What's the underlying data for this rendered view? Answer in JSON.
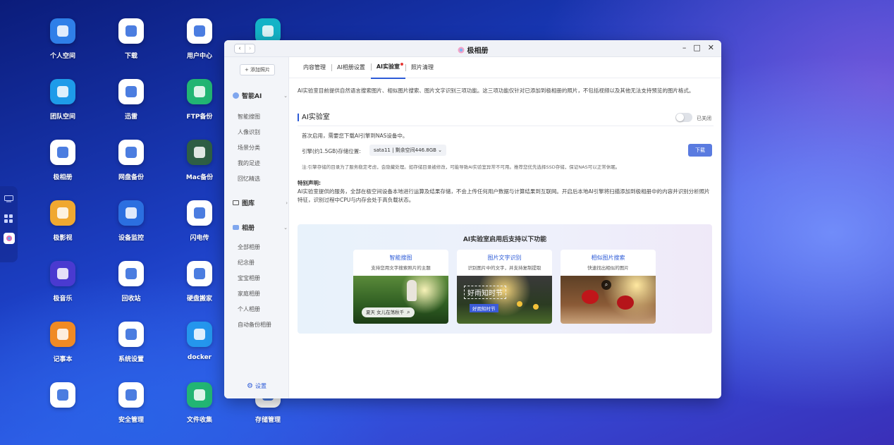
{
  "desktop": {
    "icons": [
      {
        "label": "个人空间",
        "icon": "folder-icon",
        "color": "#2f7fe8"
      },
      {
        "label": "下载",
        "icon": "download-globe-icon",
        "color": "#ffffff"
      },
      {
        "label": "用户中心",
        "icon": "user-avatar-icon",
        "color": "#ffffff"
      },
      {
        "label": "",
        "icon": "audio-wave-icon",
        "color": "#14b3c7"
      },
      {
        "label": "团队空间",
        "icon": "team-folder-icon",
        "color": "#1e9be9"
      },
      {
        "label": "迅雷",
        "icon": "thunder-bird-icon",
        "color": "#ffffff"
      },
      {
        "label": "FTP备份",
        "icon": "ftp-icon",
        "color": "#22b573"
      },
      {
        "label": "极相册",
        "icon": "photo-flower-icon",
        "color": "#ffffff"
      },
      {
        "label": "网盘备份",
        "icon": "cloud-upload-icon",
        "color": "#ffffff"
      },
      {
        "label": "Mac备份",
        "icon": "time-machine-icon",
        "color": "#2e5e44"
      },
      {
        "label": "极影视",
        "icon": "video-icon",
        "color": "#f0a830"
      },
      {
        "label": "设备监控",
        "icon": "chart-monitor-icon",
        "color": "#2b6fe0"
      },
      {
        "label": "闪电传",
        "icon": "lightning-transfer-icon",
        "color": "#ffffff"
      },
      {
        "label": "极音乐",
        "icon": "music-note-icon",
        "color": "#4a3ad0"
      },
      {
        "label": "回收站",
        "icon": "trash-icon",
        "color": "#ffffff"
      },
      {
        "label": "硬盘搬家",
        "icon": "disk-move-icon",
        "color": "#ffffff"
      },
      {
        "label": "记事本",
        "icon": "notepad-icon",
        "color": "#f08a24"
      },
      {
        "label": "系统设置",
        "icon": "settings-dial-icon",
        "color": "#ffffff"
      },
      {
        "label": "docker",
        "icon": "docker-whale-icon",
        "color": "#2496ed"
      },
      {
        "label": "",
        "icon": "disk-icon",
        "color": "#ffffff"
      },
      {
        "label": "安全管理",
        "icon": "shield-plus-icon",
        "color": "#ffffff"
      },
      {
        "label": "文件收集",
        "icon": "file-collect-icon",
        "color": "#22b573"
      },
      {
        "label": "存储管理",
        "icon": "storage-icon",
        "color": "#ffffff"
      }
    ]
  },
  "window": {
    "title": "极相册",
    "controls": {
      "minimize": "–",
      "maximize": "□",
      "close": "✕"
    },
    "nav": {
      "back": "‹",
      "forward": "›"
    }
  },
  "sidebar": {
    "add_photo": "+ 添加照片",
    "groups": [
      {
        "label": "智能AI",
        "items": [
          "智能搜图",
          "人像识别",
          "场景分类",
          "我的足迹",
          "回忆精选"
        ]
      },
      {
        "label": "图库",
        "items": []
      },
      {
        "label": "相册",
        "items": [
          "全部相册",
          "纪念册",
          "宝宝相册",
          "家庭相册",
          "个人相册",
          "自动备份相册"
        ]
      }
    ],
    "settings": "设置"
  },
  "tabs": [
    "内容管理",
    "AI相册设置",
    "AI实验室",
    "照片清理"
  ],
  "active_tab": "AI实验室",
  "main": {
    "description": "AI实验室目前提供自然语言搜索图片、相似图片搜索、图片文字识别三项功能。这三项功能仅针对已添加到极相册的照片，不包括视频以及其他无法支持预览的图片格式。",
    "section_title": "AI实验室",
    "toggle_label": "已关闭",
    "first_use": "首次启用，需要您下载AI引擎到NAS设备中。",
    "storage_label": "引擎(约1.5GB)存储位置:",
    "storage_value": "sata11 | 剩余空间446.8GB ⌄",
    "download_button": "下载",
    "note": "注:引擎存储的目录为了服务稳定考虑，会隐藏处理。如存储目录被修改，可能导致AI实验室异常不可用。推荐您优先选择SSD存储，保证NAS可以正常休眠。",
    "statement_title": "特别声明:",
    "statement": "AI实验室提供的服务，全部在极空间设备本地进行运算及结果存储，不会上传任何用户数据与计算结果到互联网。开启后本地AI引擎将扫描添加到极相册中的内容并识别分析照片特征，识别过程中CPU与内存会处于高负载状态。"
  },
  "features": {
    "title": "AI实验室启用后支持以下功能",
    "cards": [
      {
        "title": "智能搜图",
        "subtitle": "支持您用文字搜索照片的主题",
        "overlay": "夏天 女儿在荡秋千"
      },
      {
        "title": "图片文字识别",
        "subtitle": "识别图片中的文字，并支持复制提取",
        "overlay": "好雨知时节",
        "overlay2": "好雨知时节"
      },
      {
        "title": "相似图片搜索",
        "subtitle": "快速找出相似的图片",
        "overlay": ""
      }
    ]
  }
}
